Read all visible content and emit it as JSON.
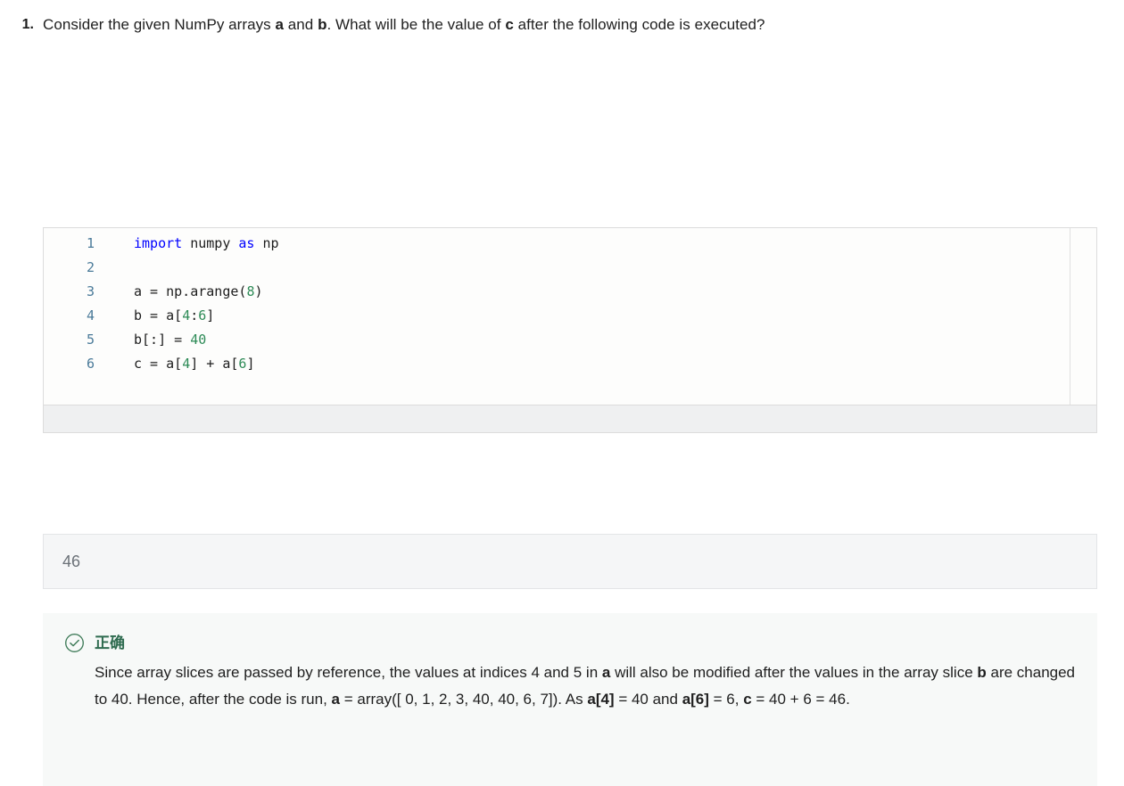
{
  "question": {
    "number": "1.",
    "prompt_parts": [
      {
        "t": "Consider the given NumPy arrays ",
        "b": false
      },
      {
        "t": "a",
        "b": true
      },
      {
        "t": " and ",
        "b": false
      },
      {
        "t": "b",
        "b": true
      },
      {
        "t": ". What will be the value of ",
        "b": false
      },
      {
        "t": "c",
        "b": true
      },
      {
        "t": " after the following code is executed?",
        "b": false
      }
    ],
    "prompt_plain": "Consider the given NumPy arrays a and b. What will be the value of c after the following code is executed?"
  },
  "code_editor": {
    "language": "python",
    "line_numbers": [
      "1",
      "2",
      "3",
      "4",
      "5",
      "6"
    ],
    "lines": [
      [
        {
          "t": "import",
          "k": "kw"
        },
        {
          "t": " numpy ",
          "k": ""
        },
        {
          "t": "as",
          "k": "kw"
        },
        {
          "t": " np",
          "k": ""
        }
      ],
      [],
      [
        {
          "t": "a = np.arange(",
          "k": ""
        },
        {
          "t": "8",
          "k": "num"
        },
        {
          "t": ")",
          "k": ""
        }
      ],
      [
        {
          "t": "b = a[",
          "k": ""
        },
        {
          "t": "4",
          "k": "num"
        },
        {
          "t": ":",
          "k": ""
        },
        {
          "t": "6",
          "k": "num"
        },
        {
          "t": "]",
          "k": ""
        }
      ],
      [
        {
          "t": "b[:] = ",
          "k": ""
        },
        {
          "t": "40",
          "k": "num"
        }
      ],
      [
        {
          "t": "c = a[",
          "k": ""
        },
        {
          "t": "4",
          "k": "num"
        },
        {
          "t": "] + a[",
          "k": ""
        },
        {
          "t": "6",
          "k": "num"
        },
        {
          "t": "]",
          "k": ""
        }
      ]
    ],
    "plain_text": "import numpy as np\n\na = np.arange(8)\nb = a[4:6]\nb[:] = 40\nc = a[4] + a[6]",
    "colors": {
      "keyword": "#0000ff",
      "number": "#2e8b57",
      "line_number": "#4a7a99",
      "text": "#1c1c1c",
      "background": "#fdfdfc",
      "footer_background": "#eff0f1"
    }
  },
  "answer_field": {
    "value": "46",
    "placeholder": ""
  },
  "feedback": {
    "icon": "check-circle-icon",
    "status_label": "正确",
    "status_color": "#2e6b4f",
    "background": "#f7f9f8",
    "explanation_parts": [
      {
        "t": "Since array slices are passed by reference, the values at indices 4 and 5 in ",
        "b": false
      },
      {
        "t": "a",
        "b": true
      },
      {
        "t": " will also be modified after the values in the array slice ",
        "b": false
      },
      {
        "t": "b",
        "b": true
      },
      {
        "t": " are changed to 40. Hence, after the code is run, ",
        "b": false
      },
      {
        "t": "a",
        "b": true
      },
      {
        "t": " = array([ 0,  1,  2,  3, 40, 40,  6,  7]). As ",
        "b": false
      },
      {
        "t": "a[4]",
        "b": true
      },
      {
        "t": " = 40 and ",
        "b": false
      },
      {
        "t": "a[6]",
        "b": true
      },
      {
        "t": " = 6, ",
        "b": false
      },
      {
        "t": "c",
        "b": true
      },
      {
        "t": " = 40 + 6 = 46.",
        "b": false
      }
    ],
    "explanation_plain": "Since array slices are passed by reference, the values at indices 4 and 5 in a will also be modified after the values in the array slice b are changed to 40. Hence, after the code is run, a = array([ 0,  1,  2,  3, 40, 40,  6,  7]). As a[4] = 40 and a[6] = 6, c = 40 + 6 = 46."
  }
}
